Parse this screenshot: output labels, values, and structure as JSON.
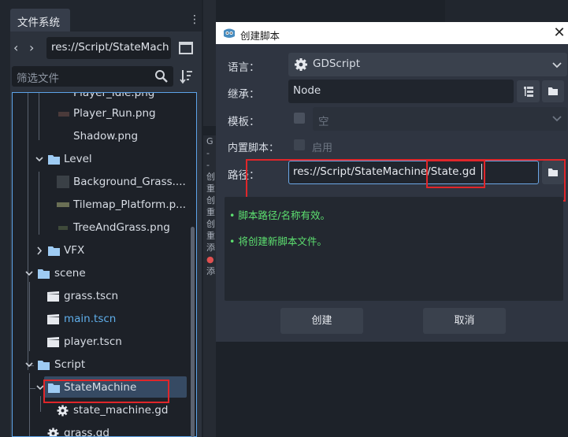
{
  "dock": {
    "tab": "文件系统",
    "menu": "⋮",
    "nav_back": "‹",
    "nav_forward": "›",
    "path": "res://Script/StateMach",
    "filter_placeholder": "筛选文件"
  },
  "tree": [
    {
      "label": "Player_Idle.png",
      "kind": "image"
    },
    {
      "label": "Player_Run.png",
      "kind": "image"
    },
    {
      "label": "Shadow.png",
      "kind": "image"
    },
    {
      "label": "Level",
      "kind": "folder"
    },
    {
      "label": "Background_Grass....",
      "kind": "image"
    },
    {
      "label": "Tilemap_Platform.p...",
      "kind": "image"
    },
    {
      "label": "TreeAndGrass.png",
      "kind": "image"
    },
    {
      "label": "VFX",
      "kind": "folder"
    },
    {
      "label": "scene",
      "kind": "folder"
    },
    {
      "label": "grass.tscn",
      "kind": "scene"
    },
    {
      "label": "main.tscn",
      "kind": "scene",
      "color": "#5faeea"
    },
    {
      "label": "player.tscn",
      "kind": "scene"
    },
    {
      "label": "Script",
      "kind": "folder"
    },
    {
      "label": "StateMachine",
      "kind": "folder"
    },
    {
      "label": "state_machine.gd",
      "kind": "script"
    },
    {
      "label": "grass.gd",
      "kind": "script"
    }
  ],
  "dialog": {
    "title": "创建脚本",
    "close": "✕",
    "language_label": "语言：",
    "language_value": "GDScript",
    "inherit_label": "继承：",
    "inherit_value": "Node",
    "template_label": "模板：",
    "template_value": "空",
    "builtin_label": "内置脚本：",
    "builtin_value": "启用",
    "path_label": "路径：",
    "path_value": "res://Script/StateMachine/State.gd",
    "status_1": "• 脚本路径/名称有效。",
    "status_2": "• 将创建新脚本文件。",
    "create_button": "创建",
    "cancel_button": "取消"
  },
  "output_strip": [
    "G",
    "-",
    "-",
    "创",
    "重",
    "创",
    "重",
    "创",
    "重",
    "添",
    "●",
    "添"
  ],
  "colors": {
    "accent": "#5da3e8",
    "status_ok": "#5de070",
    "annotation": "#e0262a",
    "selection": "#364a63"
  }
}
